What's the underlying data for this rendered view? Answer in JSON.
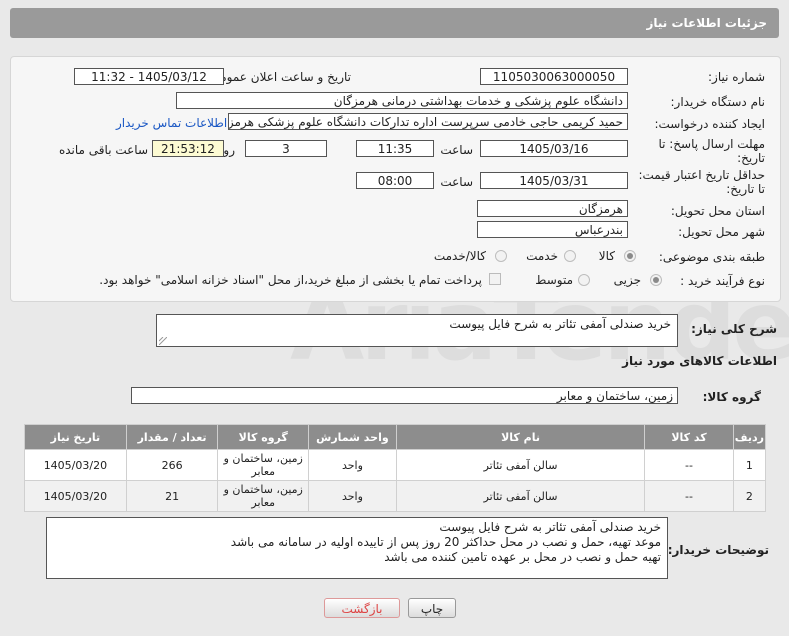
{
  "header": {
    "title": "جزئیات اطلاعات نیاز"
  },
  "watermark": "AriaTender.net",
  "form": {
    "need_number_label": "شماره نیاز:",
    "need_number": "1105030063000050",
    "announce_label": "تاریخ و ساعت اعلان عمومی:",
    "announce_value": "1405/03/12 - 11:32",
    "buyer_org_label": "نام دستگاه خریدار:",
    "buyer_org": "دانشگاه علوم پزشکی و خدمات بهداشتی درمانی هرمزگان",
    "creator_label": "ایجاد کننده درخواست:",
    "creator": "حمید کریمی حاجی خادمی سرپرست اداره تدارکات دانشگاه علوم پزشکی هرمزگان",
    "contact_link": "اطلاعات تماس خریدار",
    "deadline_label_1": "مهلت ارسال پاسخ: تا",
    "deadline_label_2": "تاریخ:",
    "deadline_date": "1405/03/16",
    "time_label": "ساعت",
    "deadline_time": "11:35",
    "day_label": "روز و",
    "days_value": "3",
    "remaining_time": "21:53:12",
    "remaining_label": "ساعت باقی مانده",
    "validity_label_1": "حداقل تاریخ اعتبار قیمت:",
    "validity_label_2": "تا تاریخ:",
    "validity_date": "1405/03/31",
    "validity_time_label": "ساعت",
    "validity_time": "08:00",
    "province_label": "استان محل تحویل:",
    "province": "هرمزگان",
    "city_label": "شهر محل تحویل:",
    "city": "بندرعباس",
    "category_label": "طبقه بندی موضوعی:",
    "category_options": [
      "کالا",
      "خدمت",
      "کالا/خدمت"
    ],
    "process_label": "نوع فرآیند خرید :",
    "process_options": [
      "جزیی",
      "متوسط"
    ],
    "payment_note": "پرداخت تمام یا بخشی از مبلغ خرید،از محل \"اسناد خزانه اسلامی\" خواهد بود."
  },
  "summary": {
    "label": "شرح کلی نیاز:",
    "value": "خرید صندلی آمفی تئاتر به شرح فایل پیوست"
  },
  "goods": {
    "section_title": "اطلاعات کالاهای مورد نیاز",
    "group_label": "گروه کالا:",
    "group_value": "زمین، ساختمان و معابر"
  },
  "table": {
    "headers": [
      "ردیف",
      "کد کالا",
      "نام کالا",
      "واحد شمارش",
      "گروه کالا",
      "تعداد / مقدار",
      "تاریخ نیاز"
    ],
    "rows": [
      [
        "1",
        "--",
        "سالن آمفی تئاتر",
        "واحد",
        "زمین، ساختمان و معابر",
        "266",
        "1405/03/20"
      ],
      [
        "2",
        "--",
        "سالن آمفی تئاتر",
        "واحد",
        "زمین، ساختمان و معابر",
        "21",
        "1405/03/20"
      ]
    ]
  },
  "buyer_notes": {
    "label": "توضیحات خریدار:",
    "lines": [
      "خرید صندلی آمفی تئاتر به شرح فایل پیوست",
      "موعد تهیه، حمل و نصب در محل حداکثر 20 روز پس از تاییده اولیه در سامانه می باشد",
      "تهیه حمل و نصب در محل بر عهده تامین کننده  می باشد"
    ]
  },
  "buttons": {
    "print": "چاپ",
    "back": "بازگشت"
  }
}
